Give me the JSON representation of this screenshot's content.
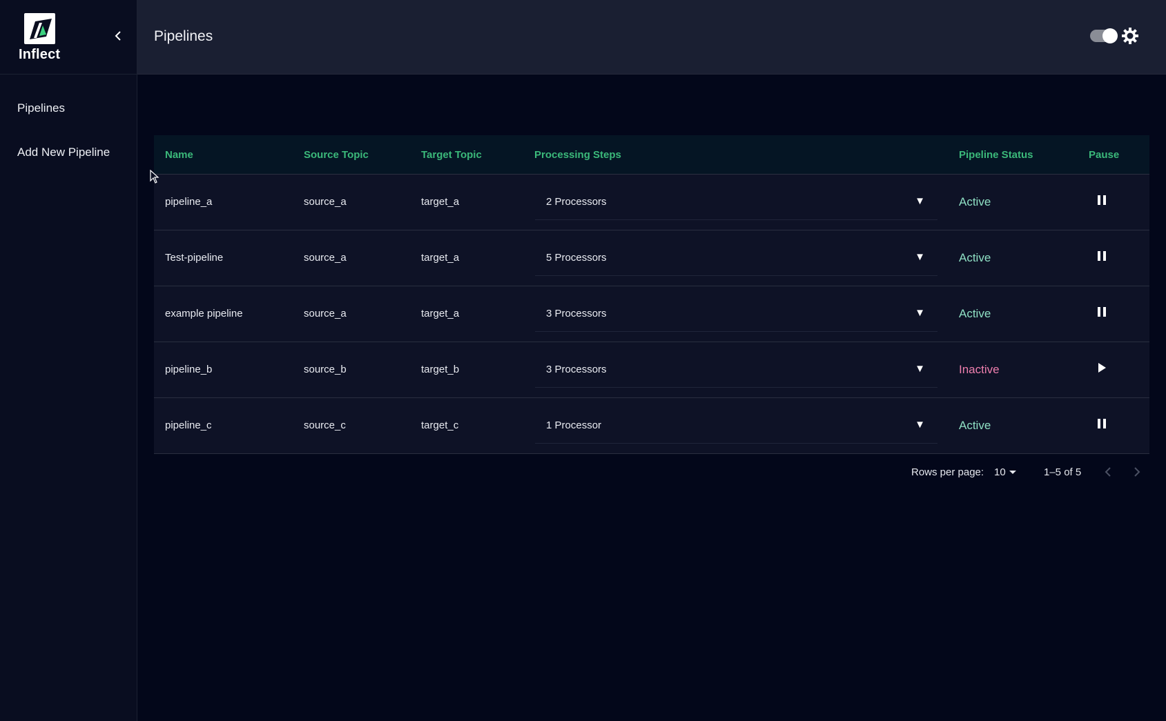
{
  "app": {
    "brand": "Inflect",
    "page_title": "Pipelines"
  },
  "sidebar": {
    "items": [
      {
        "label": "Pipelines"
      },
      {
        "label": "Add New Pipeline"
      }
    ]
  },
  "table": {
    "columns": [
      "Name",
      "Source Topic",
      "Target Topic",
      "Processing Steps",
      "Pipeline Status",
      "Pause"
    ],
    "rows": [
      {
        "name": "pipeline_a",
        "source": "source_a",
        "target": "target_a",
        "steps": "2 Processors",
        "status": "Active",
        "action": "pause-icon"
      },
      {
        "name": "Test-pipeline",
        "source": "source_a",
        "target": "target_a",
        "steps": "5 Processors",
        "status": "Active",
        "action": "pause-icon"
      },
      {
        "name": "example pipeline",
        "source": "source_a",
        "target": "target_a",
        "steps": "3 Processors",
        "status": "Active",
        "action": "pause-icon"
      },
      {
        "name": "pipeline_b",
        "source": "source_b",
        "target": "target_b",
        "steps": "3 Processors",
        "status": "Inactive",
        "action": "play-icon"
      },
      {
        "name": "pipeline_c",
        "source": "source_c",
        "target": "target_c",
        "steps": "1 Processor",
        "status": "Active",
        "action": "pause-icon"
      }
    ]
  },
  "pagination": {
    "rows_per_page_label": "Rows per page:",
    "rows_per_page": "10",
    "range": "1–5 of 5"
  },
  "colors": {
    "header_accent": "#3bb97a",
    "active": "#8fe0c4",
    "inactive": "#ee7fae"
  }
}
